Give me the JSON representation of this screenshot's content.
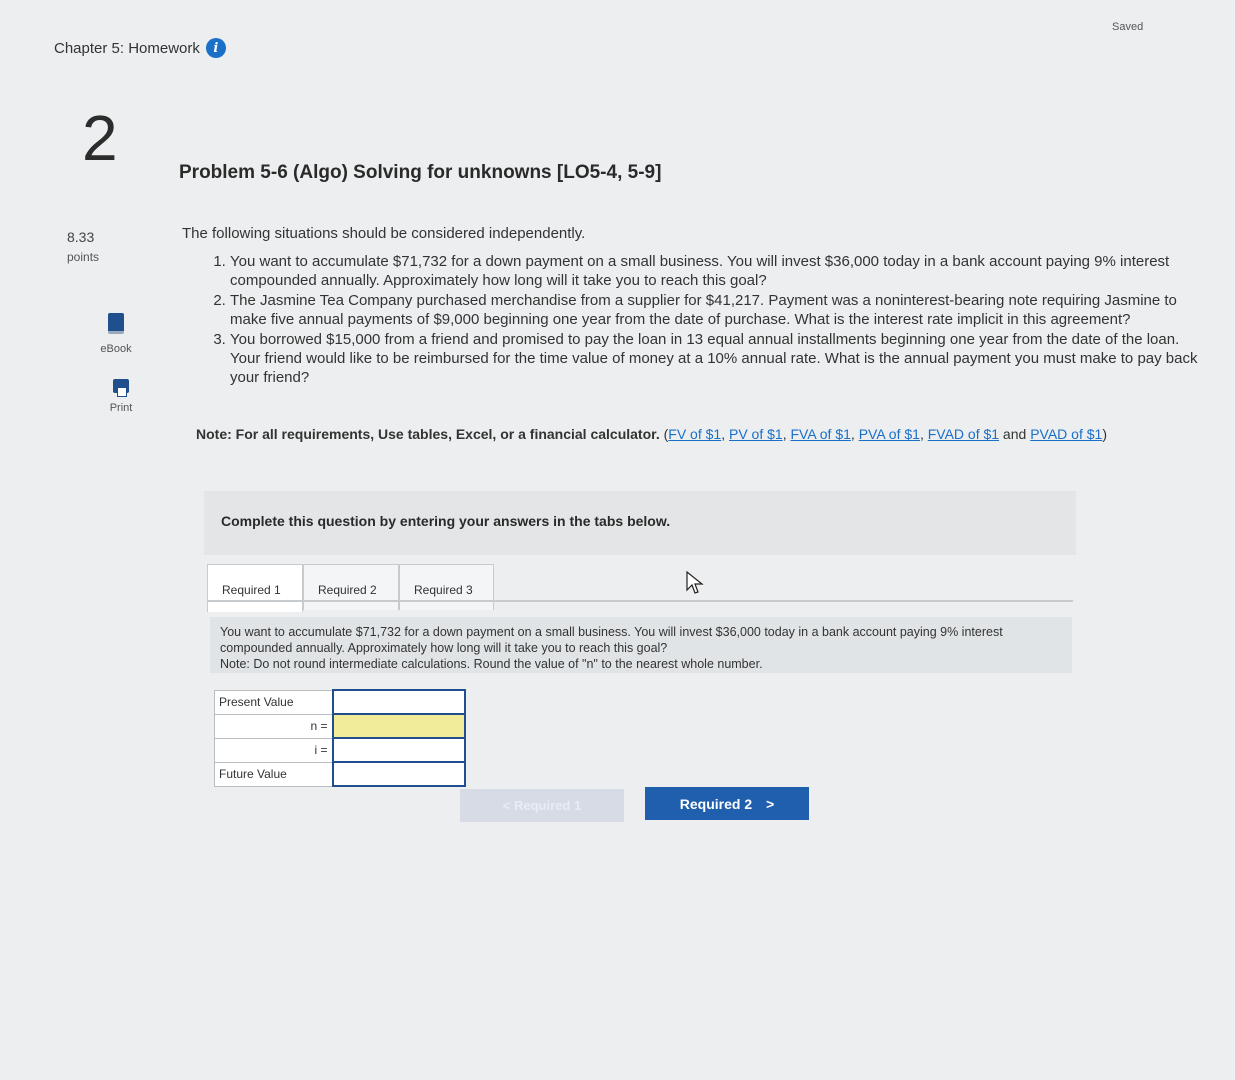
{
  "status": "Saved",
  "assignment": {
    "title": "Chapter 5: Homework"
  },
  "question": {
    "number": "2",
    "points_value": "8.33",
    "points_label": "points"
  },
  "tools": {
    "ebook_label": "eBook",
    "print_label": "Print"
  },
  "problem": {
    "title": "Problem 5-6 (Algo) Solving for unknowns [LO5-4, 5-9]",
    "intro": "The following situations should be considered independently.",
    "situations": [
      "You want to accumulate $71,732 for a down payment on a small business. You will invest $36,000 today in a bank account paying 9% interest compounded annually. Approximately how long will it take you to reach this goal?",
      "The Jasmine Tea Company purchased merchandise from a supplier for $41,217. Payment was a noninterest-bearing note requiring Jasmine to make five annual payments of $9,000 beginning one year from the date of purchase. What is the interest rate implicit in this agreement?",
      "You borrowed $15,000 from a friend and promised to pay the loan in 13 equal annual installments beginning one year from the date of the loan. Your friend would like to be reimbursed for the time value of money at a 10% annual rate. What is the annual payment you must make to pay back your friend?"
    ],
    "note_bold": "Note: For all requirements, Use tables, Excel, or a financial calculator.",
    "note_open": " (",
    "note_links": [
      "FV of $1",
      "PV of $1",
      "FVA of $1",
      "PVA of $1",
      "FVAD of $1",
      "PVAD of $1"
    ],
    "note_sep": ", ",
    "note_and": " and ",
    "note_close": ")"
  },
  "instruction": "Complete this question by entering your answers in the tabs below.",
  "tabs": [
    {
      "label": "Required 1"
    },
    {
      "label": "Required 2"
    },
    {
      "label": "Required 3"
    }
  ],
  "required1": {
    "description": "You want to accumulate $71,732 for a down payment on a small business. You will invest $36,000 today in a bank account paying 9% interest compounded annually. Approximately how long will it take you to reach this goal?",
    "note": "Note: Do not round intermediate calculations. Round the value of \"n\" to the nearest whole number.",
    "rows": [
      {
        "label": "Present Value",
        "symbol": "",
        "value": ""
      },
      {
        "label": "",
        "symbol": "n =",
        "value": ""
      },
      {
        "label": "",
        "symbol": "i =",
        "value": ""
      },
      {
        "label": "Future Value",
        "symbol": "",
        "value": ""
      }
    ]
  },
  "nav": {
    "prev_label": "< Required 1",
    "next_label": "Required 2",
    "next_chevron": ">"
  },
  "colors": {
    "accent": "#1f5fae",
    "input_highlight": "#f0ec9a",
    "info_icon": "#1a6fc9"
  }
}
